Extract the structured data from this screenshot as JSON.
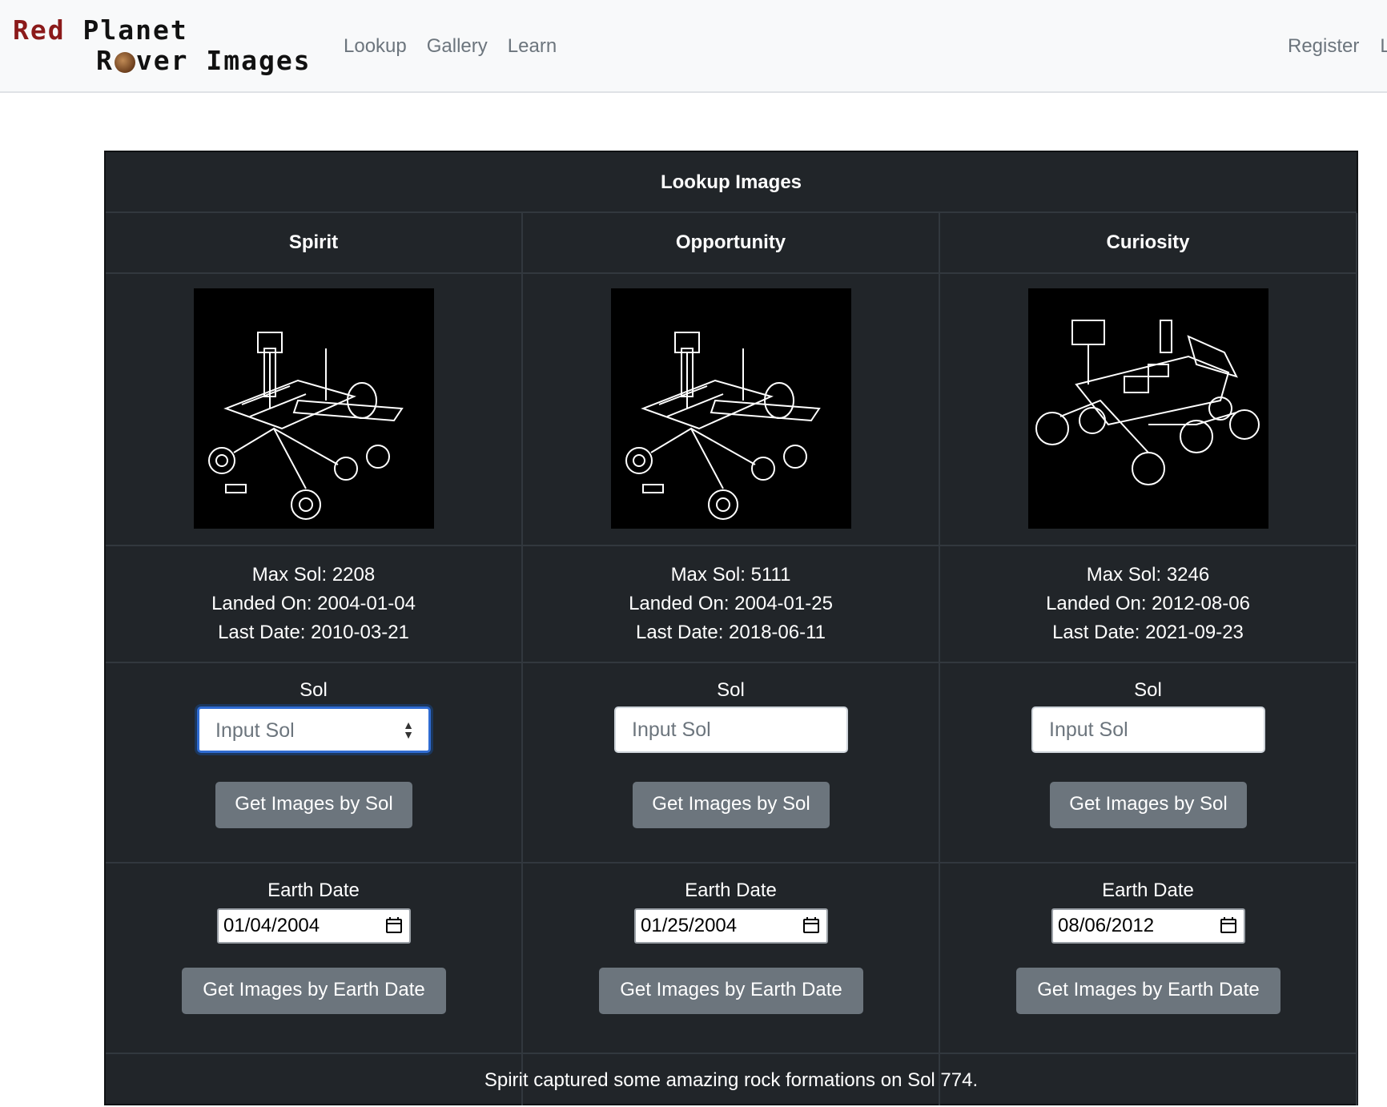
{
  "nav": {
    "logo_line1_red": "Red",
    "logo_line1_rest": "Planet",
    "logo_line2_a": "R",
    "logo_line2_b": "ver Images",
    "links": [
      "Lookup",
      "Gallery",
      "Learn"
    ],
    "register": "Register",
    "login_partial": "L"
  },
  "panel": {
    "title": "Lookup Images",
    "rovers": [
      {
        "name": "Spirit",
        "max_sol": "Max Sol: 2208",
        "landed_on": "Landed On: 2004-01-04",
        "last_date": "Last Date: 2010-03-21",
        "sol_label": "Sol",
        "sol_placeholder": "Input Sol",
        "sol_button": "Get Images by Sol",
        "date_label": "Earth Date",
        "date_value": "01/04/2004",
        "date_button": "Get Images by Earth Date"
      },
      {
        "name": "Opportunity",
        "max_sol": "Max Sol: 5111",
        "landed_on": "Landed On: 2004-01-25",
        "last_date": "Last Date: 2018-06-11",
        "sol_label": "Sol",
        "sol_placeholder": "Input Sol",
        "sol_button": "Get Images by Sol",
        "date_label": "Earth Date",
        "date_value": "01/25/2004",
        "date_button": "Get Images by Earth Date"
      },
      {
        "name": "Curiosity",
        "max_sol": "Max Sol: 3246",
        "landed_on": "Landed On: 2012-08-06",
        "last_date": "Last Date: 2021-09-23",
        "sol_label": "Sol",
        "sol_placeholder": "Input Sol",
        "sol_button": "Get Images by Sol",
        "date_label": "Earth Date",
        "date_value": "08/06/2012",
        "date_button": "Get Images by Earth Date"
      }
    ],
    "footer": "Spirit captured some amazing rock formations on Sol 774."
  },
  "colors": {
    "navbar_bg": "#f8f9fa",
    "panel_bg": "#212529",
    "button_bg": "#6c757d",
    "focus_border": "#2f6bd1",
    "logo_red": "#8b1a1a"
  }
}
